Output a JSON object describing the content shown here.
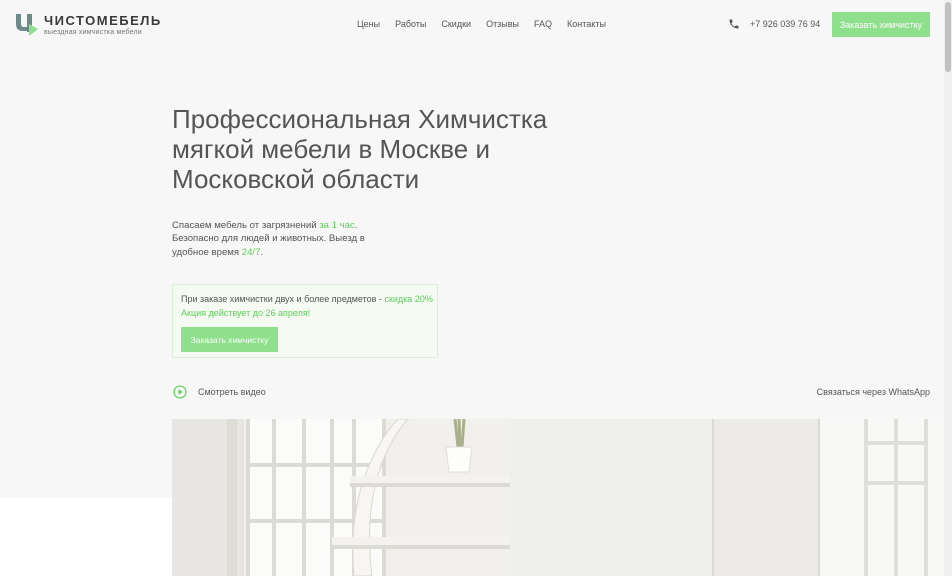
{
  "brand": {
    "name": "ЧИСТОМЕБЕЛЬ",
    "tagline": "выездная химчистка мебели",
    "accent": "#8fe08c",
    "accent_text": "#5fcf5b"
  },
  "nav": [
    {
      "label": "Цены"
    },
    {
      "label": "Работы"
    },
    {
      "label": "Скидки"
    },
    {
      "label": "Отзывы"
    },
    {
      "label": "FAQ"
    },
    {
      "label": "Контакты"
    }
  ],
  "header": {
    "phone": "+7 926 039 76 94",
    "phone_icon": "phone-icon",
    "cta_label": "Заказать химчистку"
  },
  "hero": {
    "title": "Профессиональная Химчистка мягкой мебели в Москве и Московской области",
    "lead_1": "Спасаем мебель от загрязнений ",
    "lead_hl_1": "за 1 час",
    "lead_2": ". Безопасно для людей и животных. Выезд в удобное время ",
    "lead_hl_2": "24/7",
    "lead_3": "."
  },
  "promo": {
    "text": "При заказе химчистки двух и более предметов - ",
    "discount": "скидка 20%",
    "deadline": "Акция действует до 26 апреля!",
    "cta_label": "Заказать химчистку"
  },
  "video": {
    "label": "Смотреть видео",
    "icon": "play-icon"
  },
  "whatsapp": {
    "label": "Связаться через WhatsApp"
  }
}
